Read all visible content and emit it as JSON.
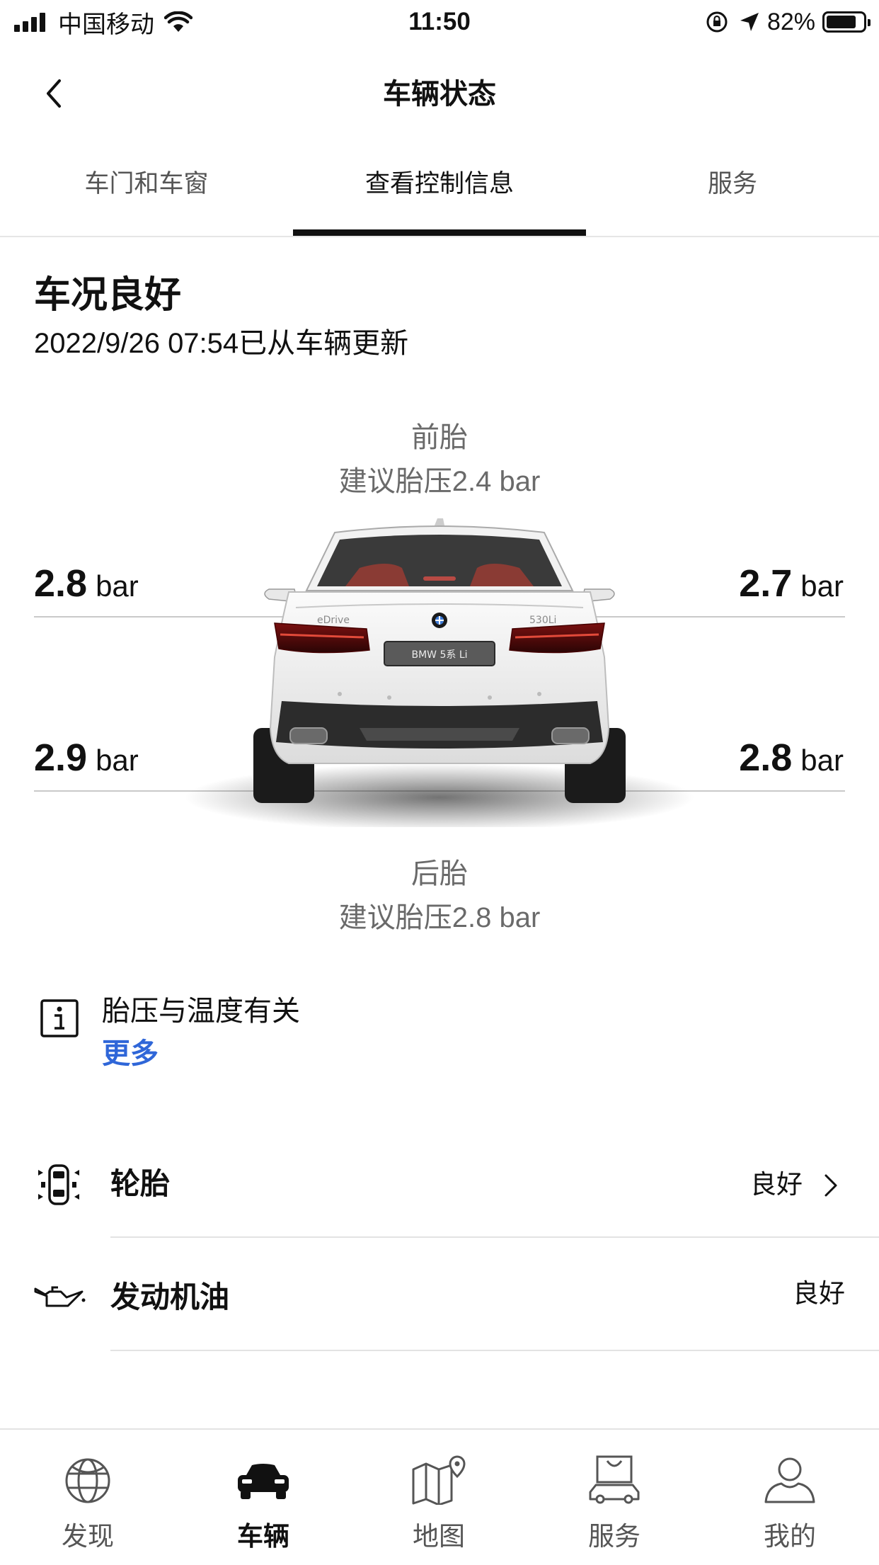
{
  "status_bar": {
    "carrier": "中国移动",
    "time": "11:50",
    "battery": "82%",
    "battery_level": 0.82
  },
  "nav": {
    "title": "车辆状态",
    "back_icon": "chevron-left-icon"
  },
  "tabs": [
    {
      "label": "车门和车窗",
      "active": false
    },
    {
      "label": "查看控制信息",
      "active": true
    },
    {
      "label": "服务",
      "active": false
    }
  ],
  "summary": {
    "title": "车况良好",
    "updated": "2022/9/26 07:54已从车辆更新"
  },
  "front": {
    "label": "前胎",
    "recommended": "建议胎压2.4 bar"
  },
  "rear": {
    "label": "后胎",
    "recommended": "建议胎压2.8 bar"
  },
  "pressures": {
    "front_left": {
      "value": "2.8",
      "unit": "bar"
    },
    "front_right": {
      "value": "2.7",
      "unit": "bar"
    },
    "rear_left": {
      "value": "2.9",
      "unit": "bar"
    },
    "rear_right": {
      "value": "2.8",
      "unit": "bar"
    }
  },
  "car": {
    "plate": "BMW 5系 Li",
    "badge_left": "eDrive",
    "badge_right": "530Li"
  },
  "info": {
    "text": "胎压与温度有关",
    "link": "更多",
    "icon": "info-icon"
  },
  "rows": [
    {
      "label": "轮胎",
      "value": "良好",
      "icon": "tire-icon",
      "has_chevron": true
    },
    {
      "label": "发动机油",
      "value": "良好",
      "icon": "oil-can-icon",
      "has_chevron": false
    }
  ],
  "tabbar": [
    {
      "label": "发现",
      "icon": "globe-icon",
      "active": false
    },
    {
      "label": "车辆",
      "icon": "car-icon",
      "active": true
    },
    {
      "label": "地图",
      "icon": "map-pin-icon",
      "active": false
    },
    {
      "label": "服务",
      "icon": "service-bag-icon",
      "active": false
    },
    {
      "label": "我的",
      "icon": "user-icon",
      "active": false
    }
  ],
  "colors": {
    "accent_link": "#2f66d8",
    "text": "#111111",
    "secondary": "#6a6a6a"
  }
}
